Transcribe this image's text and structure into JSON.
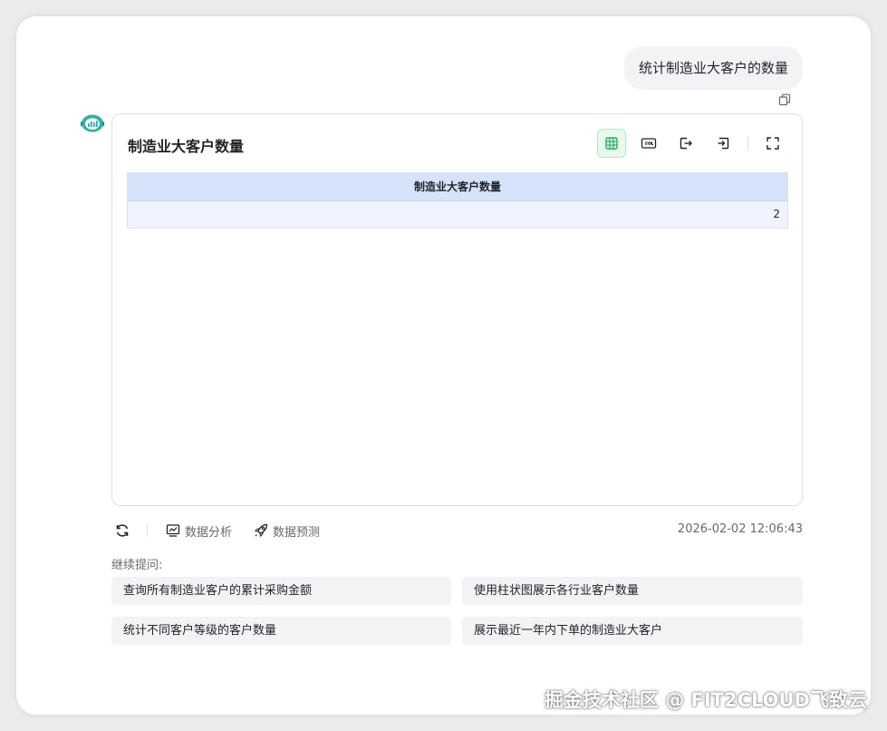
{
  "chat": {
    "user_message": "统计制造业大客户的数量"
  },
  "card": {
    "title": "制造业大客户数量",
    "toolbar": {
      "table_icon": "table-icon",
      "sql_icon": "sql-icon",
      "export_icon": "export-icon",
      "import_icon": "import-icon",
      "fullscreen_icon": "fullscreen-icon"
    },
    "table": {
      "columns": [
        "制造业大客户数量"
      ],
      "rows": [
        [
          "2"
        ]
      ]
    }
  },
  "actions": {
    "refresh_icon": "refresh-icon",
    "analysis_label": "数据分析",
    "predict_label": "数据预测"
  },
  "timestamp": "2026-02-02 12:06:43",
  "followup": {
    "label": "继续提问:",
    "suggestions": [
      "查询所有制造业客户的累计采购金额",
      "使用柱状图展示各行业客户数量",
      "统计不同客户等级的客户数量",
      "展示最近一年内下单的制造业大客户"
    ]
  },
  "watermark": "掘金技术社区 @ FIT2CLOUD飞致云",
  "colors": {
    "accent_green": "#1fb45a",
    "table_header_bg": "#d6e4fb",
    "table_row_bg": "#eef3fd"
  }
}
